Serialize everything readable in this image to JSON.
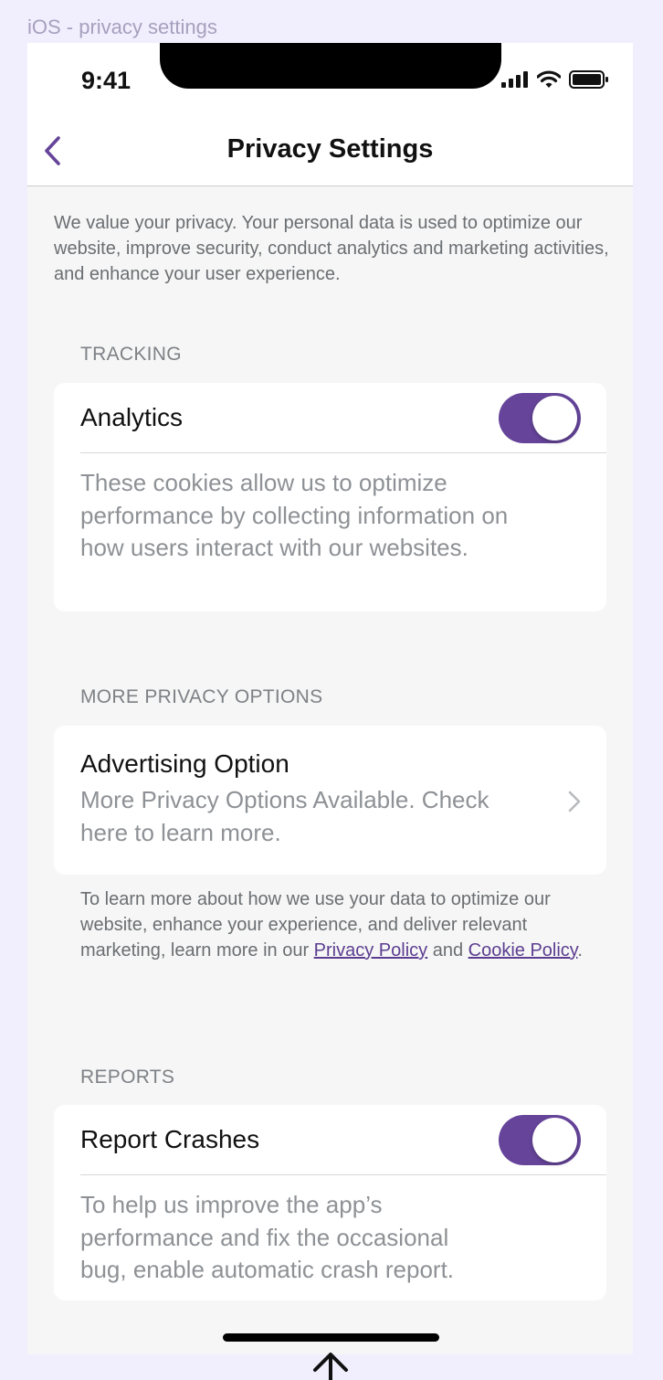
{
  "frame": {
    "label": "iOS - privacy settings"
  },
  "status_bar": {
    "time": "9:41"
  },
  "nav": {
    "title": "Privacy Settings"
  },
  "intro": "We value your privacy. Your personal data is used to optimize our website, improve security, conduct analytics and marketing activities, and enhance your user experience.",
  "sections": {
    "tracking": {
      "header": "TRACKING",
      "title": "Analytics",
      "toggle_on": true,
      "description": "These cookies allow us to optimize performance by collecting information on how users interact with our websites."
    },
    "more": {
      "header": "MORE PRIVACY OPTIONS",
      "title": "Advertising Option",
      "subtitle": "More Privacy Options Available. Check here to learn more."
    },
    "note": {
      "text_before": "To learn more about how we use your data to optimize our website, enhance your experience, and deliver relevant marketing, learn more in our ",
      "privacy_link": "Privacy Policy",
      "and": " and ",
      "cookie_link": "Cookie Policy",
      "end": "."
    },
    "reports": {
      "header": "REPORTS",
      "title": "Report Crashes",
      "toggle_on": true,
      "description": "To help us improve the app’s performance and fix the occasional bug, enable automatic crash report."
    }
  },
  "colors": {
    "accent": "#65449a",
    "background": "#f5f6f5",
    "canvas": "#f1eefe"
  },
  "icons": {
    "back": "chevron-left-icon",
    "chevron": "chevron-right-icon",
    "signal": "cellular-signal-icon",
    "wifi": "wifi-icon",
    "battery": "battery-icon",
    "scroll": "arrow-up-icon"
  }
}
